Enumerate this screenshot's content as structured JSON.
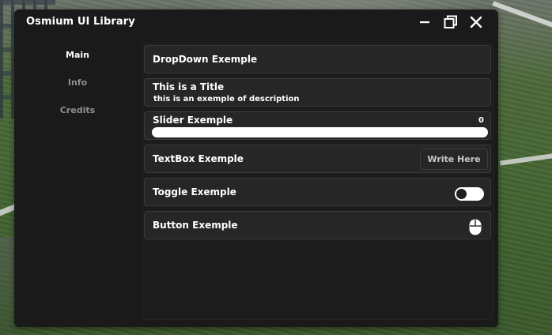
{
  "window": {
    "title": "Osmium UI Library"
  },
  "sidebar": {
    "items": [
      {
        "label": "Main",
        "active": true
      },
      {
        "label": "Info",
        "active": false
      },
      {
        "label": "Credits",
        "active": false
      }
    ]
  },
  "elements": {
    "dropdown": {
      "label": "DropDown Exemple"
    },
    "title_block": {
      "title": "This is a Title",
      "description": "this is an exemple of description"
    },
    "slider": {
      "label": "Slider Exemple",
      "value": "0",
      "fill_fraction": 0
    },
    "textbox": {
      "label": "TextBox Exemple",
      "placeholder": "Write Here"
    },
    "toggle": {
      "label": "Toggle Exemple",
      "state": "off"
    },
    "button": {
      "label": "Button Exemple",
      "icon": "mouse-icon"
    }
  },
  "colors": {
    "window_bg": "#1a1a1a",
    "row_bg": "#262626",
    "row_border": "#3a3a3a",
    "text_primary": "#ffffff",
    "text_muted": "#8f8f8f"
  }
}
